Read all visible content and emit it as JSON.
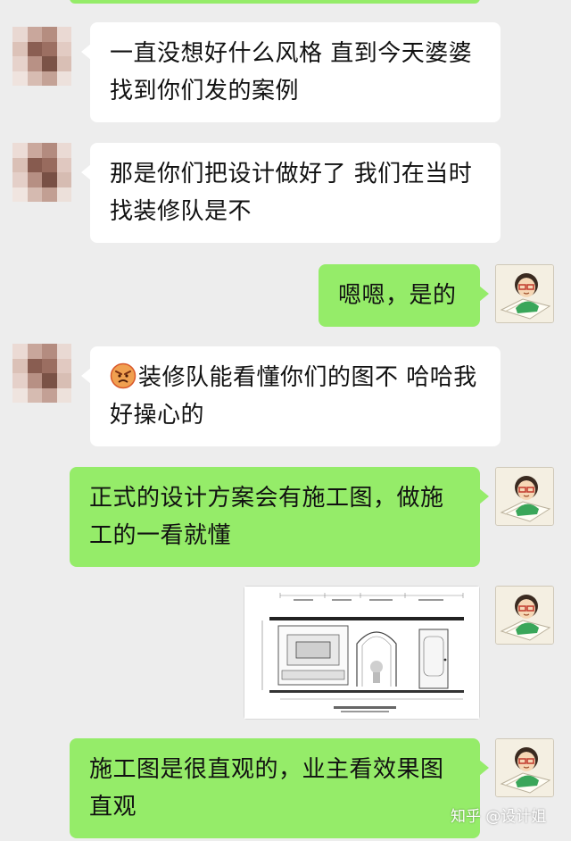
{
  "messages": [
    {
      "side": "received",
      "text": "一直没想好什么风格 直到今天婆婆找到你们发的案例"
    },
    {
      "side": "received",
      "text": "那是你们把设计做好了  我们在当时找装修队是不"
    },
    {
      "side": "sent",
      "text": "嗯嗯，是的"
    },
    {
      "side": "received",
      "emoji": "angry-face",
      "text": "装修队能看懂你们的图不  哈哈我好操心的"
    },
    {
      "side": "sent",
      "text": "正式的设计方案会有施工图，做施工的一看就懂"
    },
    {
      "side": "sent",
      "type": "image",
      "image": "construction-drawing-elevation"
    },
    {
      "side": "sent",
      "text": "施工图是很直观的，业主看效果图直观"
    }
  ],
  "watermark": "知乎 @设计姐",
  "colors": {
    "background": "#ededed",
    "received_bubble": "#ffffff",
    "sent_bubble": "#95ec69"
  }
}
